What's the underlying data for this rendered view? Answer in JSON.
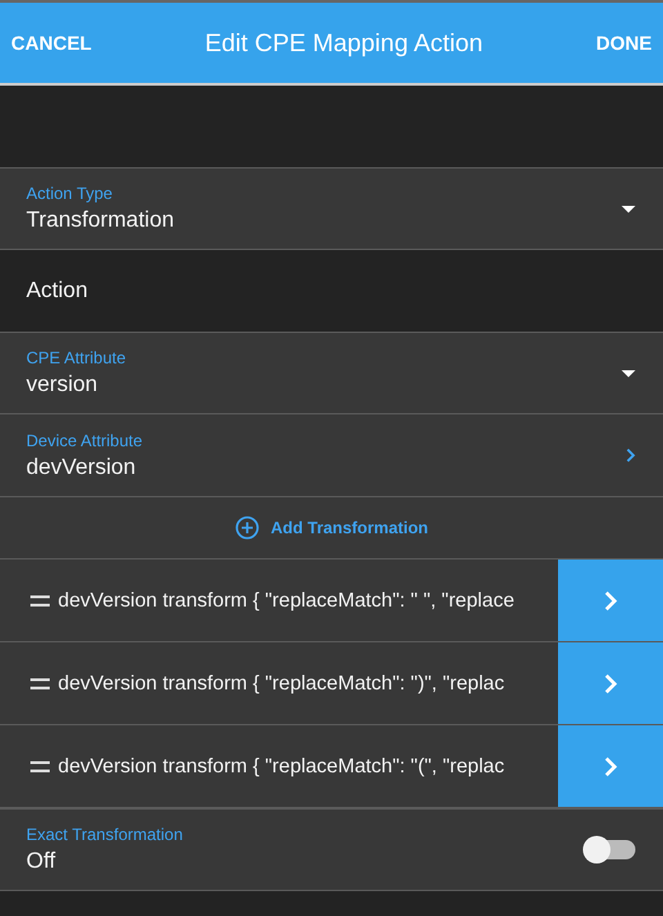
{
  "header": {
    "cancel": "CANCEL",
    "title": "Edit CPE Mapping Action",
    "done": "DONE"
  },
  "action_type": {
    "label": "Action Type",
    "value": "Transformation",
    "kind": "dropdown"
  },
  "section_title": "Action",
  "fields": [
    {
      "label": "CPE Attribute",
      "value": "version",
      "kind": "dropdown"
    },
    {
      "label": "Device Attribute",
      "value": "devVersion",
      "kind": "link"
    }
  ],
  "add_button": "Add Transformation",
  "transformations": [
    {
      "text": "devVersion transform { \"replaceMatch\": \" \", \"replace"
    },
    {
      "text": "devVersion transform { \"replaceMatch\": \")\", \"replac"
    },
    {
      "text": "devVersion transform { \"replaceMatch\": \"(\", \"replac"
    }
  ],
  "exact": {
    "label": "Exact Transformation",
    "value": "Off",
    "on": false
  }
}
